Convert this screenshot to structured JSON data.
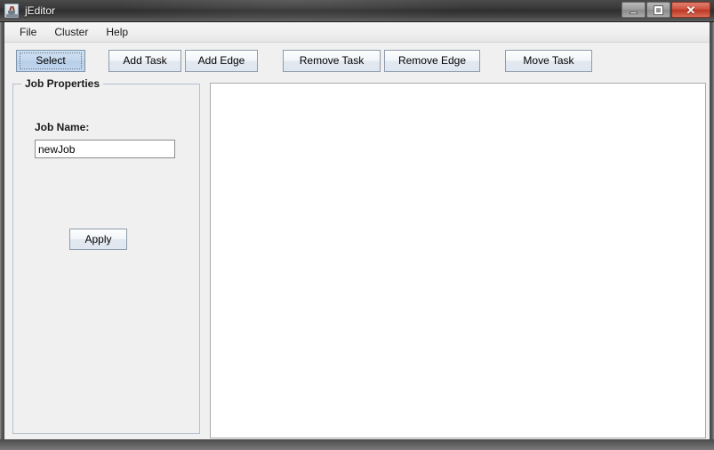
{
  "window": {
    "title": "jEditor",
    "icon": "java-coffee-cup-icon",
    "controls": {
      "minimize_label": "—",
      "maximize_label": "□",
      "close_label": "✕"
    }
  },
  "menubar": {
    "items": [
      {
        "label": "File"
      },
      {
        "label": "Cluster"
      },
      {
        "label": "Help"
      }
    ]
  },
  "toolbar": {
    "groups": [
      {
        "buttons": [
          {
            "label": "Select",
            "selected": true
          }
        ]
      },
      {
        "buttons": [
          {
            "label": "Add Task",
            "selected": false
          },
          {
            "label": "Add Edge",
            "selected": false
          }
        ]
      },
      {
        "buttons": [
          {
            "label": "Remove Task",
            "selected": false
          },
          {
            "label": "Remove Edge",
            "selected": false
          }
        ]
      },
      {
        "buttons": [
          {
            "label": "Move Task",
            "selected": false
          }
        ]
      }
    ]
  },
  "properties_panel": {
    "group_title": "Job Properties",
    "job_name_label": "Job Name:",
    "job_name_value": "newJob",
    "job_name_placeholder": "",
    "apply_label": "Apply"
  },
  "canvas": {
    "content": "",
    "background": "#ffffff"
  },
  "colors": {
    "titlebar_dark": "#3a3a3a",
    "close_red": "#bb3724",
    "panel_bg": "#f0f0f0",
    "button_face": "#e3e9f1",
    "selected_button": "#c2d6ec",
    "groupbox_border": "#b3c0d1",
    "canvas_white": "#ffffff"
  }
}
